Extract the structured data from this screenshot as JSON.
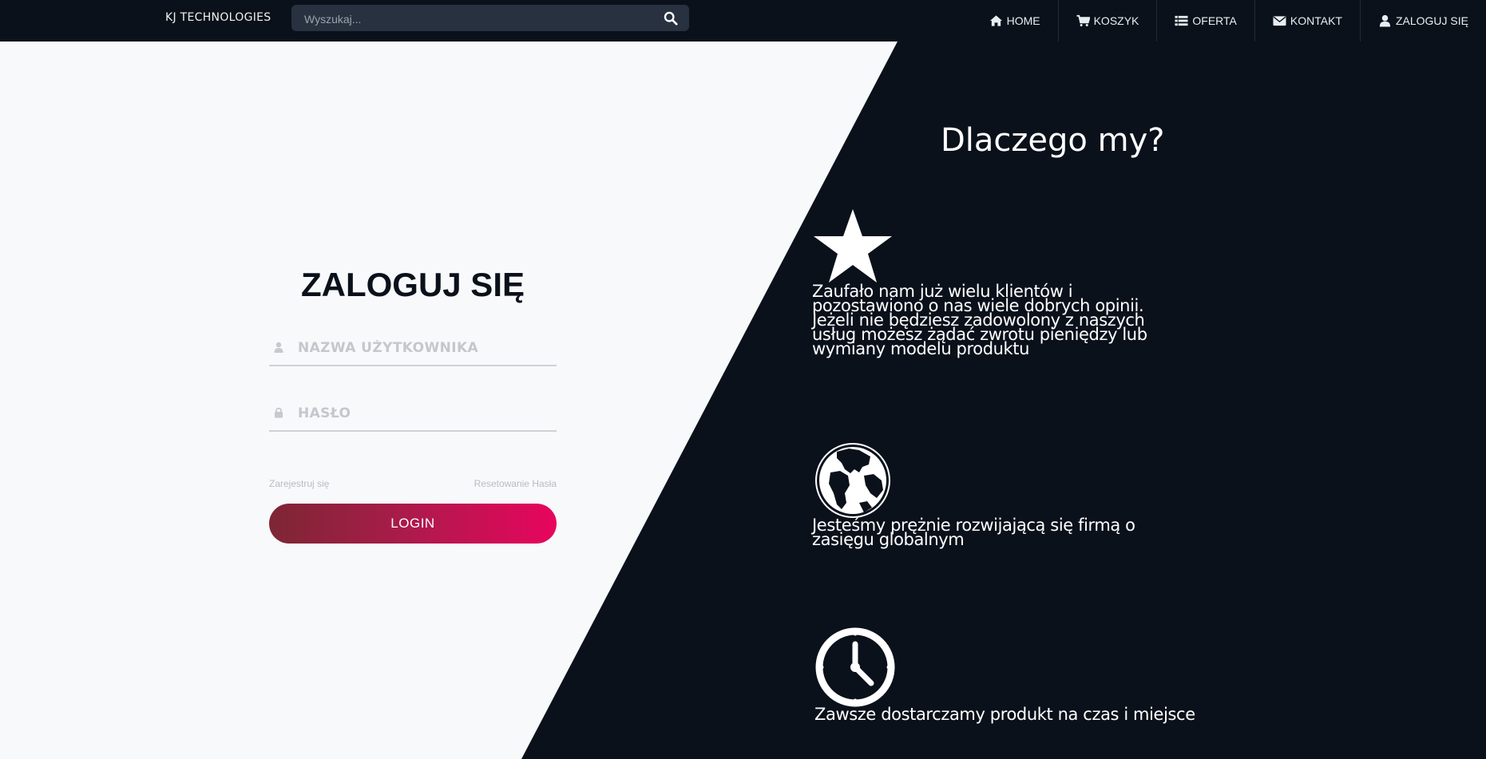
{
  "header": {
    "brand": "KJ TECHNOLOGIES",
    "search_placeholder": "Wyszukaj...",
    "nav": [
      {
        "label": "HOME",
        "icon": "home-icon"
      },
      {
        "label": "KOSZYK",
        "icon": "cart-icon"
      },
      {
        "label": "OFERTA",
        "icon": "list-icon"
      },
      {
        "label": "KONTAKT",
        "icon": "envelope-icon"
      },
      {
        "label": "ZALOGUJ SIĘ",
        "icon": "user-icon"
      }
    ]
  },
  "login": {
    "title": "ZALOGUJ SIĘ",
    "username_placeholder": "NAZWA UŻYTKOWNIKA",
    "password_placeholder": "HASŁO",
    "register_link": "Zarejestruj się",
    "reset_link": "Resetowanie Hasła",
    "login_button": "LOGIN"
  },
  "why": {
    "title": "Dlaczego my?",
    "features": [
      {
        "icon": "star-icon",
        "text": "Zaufało nam już wielu klientów i pozostawiono o nas wiele dobrych opinii. Jeżeli nie będziesz zadowolony z naszych usług możesz żądać zwrotu pieniędzy lub wymiany modelu produktu"
      },
      {
        "icon": "globe-icon",
        "text": "Jesteśmy prężnie rozwijającą się firmą o zasięgu globalnym"
      },
      {
        "icon": "clock-icon",
        "text": "Zawsze dostarczamy produkt na czas i miejsce"
      }
    ]
  },
  "colors": {
    "dark_bg": "#0b111b",
    "light_bg": "#f8f9fb",
    "button_gradient_start": "#7d2633",
    "button_gradient_end": "#e8055e"
  }
}
